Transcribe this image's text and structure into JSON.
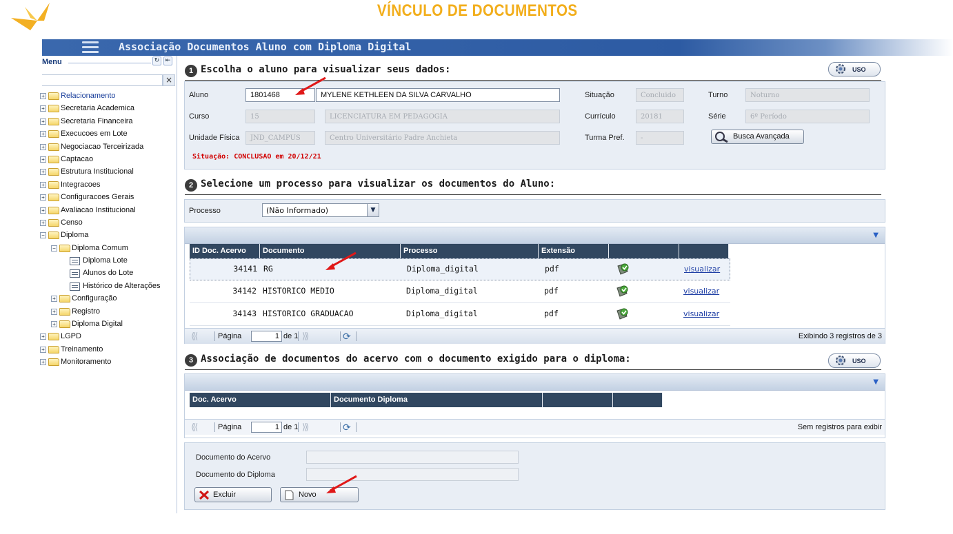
{
  "banner": {
    "title": "VÍNCULO DE DOCUMENTOS"
  },
  "app": {
    "title": "Associação Documentos Aluno com Diploma Digital"
  },
  "sidebar": {
    "menu_label": "Menu",
    "search_clear": "×",
    "items": [
      {
        "label": "Relacionamento",
        "level": 0,
        "icon": "folder-icon",
        "expander": "plus",
        "active": true
      },
      {
        "label": "Secretaria Academica",
        "level": 0,
        "icon": "folder-icon",
        "expander": "plus"
      },
      {
        "label": "Secretaria Financeira",
        "level": 0,
        "icon": "folder-icon",
        "expander": "plus"
      },
      {
        "label": "Execucoes em Lote",
        "level": 0,
        "icon": "folder-icon",
        "expander": "plus"
      },
      {
        "label": "Negociacao Terceirizada",
        "level": 0,
        "icon": "folder-icon",
        "expander": "plus"
      },
      {
        "label": "Captacao",
        "level": 0,
        "icon": "folder-icon",
        "expander": "plus"
      },
      {
        "label": "Estrutura Institucional",
        "level": 0,
        "icon": "folder-icon",
        "expander": "plus"
      },
      {
        "label": "Integracoes",
        "level": 0,
        "icon": "folder-icon",
        "expander": "plus"
      },
      {
        "label": "Configuracoes Gerais",
        "level": 0,
        "icon": "folder-icon",
        "expander": "plus"
      },
      {
        "label": "Avaliacao Institucional",
        "level": 0,
        "icon": "folder-icon",
        "expander": "plus"
      },
      {
        "label": "Censo",
        "level": 0,
        "icon": "folder-icon",
        "expander": "plus"
      },
      {
        "label": "Diploma",
        "level": 0,
        "icon": "open-folder-icon",
        "expander": "minus"
      },
      {
        "label": "Diploma Comum",
        "level": 1,
        "icon": "open-folder-icon",
        "expander": "minus"
      },
      {
        "label": "Diploma Lote",
        "level": 2,
        "icon": "page-icon",
        "expander": ""
      },
      {
        "label": "Alunos do Lote",
        "level": 2,
        "icon": "page-icon",
        "expander": ""
      },
      {
        "label": "Histórico de Alterações",
        "level": 2,
        "icon": "page-icon",
        "expander": ""
      },
      {
        "label": "Configuração",
        "level": 1,
        "icon": "folder-icon",
        "expander": "plus"
      },
      {
        "label": "Registro",
        "level": 1,
        "icon": "folder-icon",
        "expander": "plus"
      },
      {
        "label": "Diploma Digital",
        "level": 1,
        "icon": "folder-icon",
        "expander": "plus"
      },
      {
        "label": "LGPD",
        "level": 0,
        "icon": "folder-icon",
        "expander": "plus"
      },
      {
        "label": "Treinamento",
        "level": 0,
        "icon": "folder-icon",
        "expander": "plus"
      },
      {
        "label": "Monitoramento",
        "level": 0,
        "icon": "folder-icon",
        "expander": "plus"
      }
    ]
  },
  "section1": {
    "step": "1",
    "title": "Escolha o aluno para visualizar seus dados:",
    "uso_label": "USO",
    "labels": {
      "aluno": "Aluno",
      "curso": "Curso",
      "unidade": "Unidade Física",
      "situacao": "Situação",
      "curriculo": "Currículo",
      "turma": "Turma Pref.",
      "turno": "Turno",
      "serie": "Série"
    },
    "values": {
      "aluno_codigo": "1801468",
      "aluno_nome": "MYLENE KETHLEEN DA SILVA CARVALHO",
      "curso_codigo": "15",
      "curso_nome": "LICENCIATURA EM PEDAGOGIA",
      "unidade_codigo": "JND_CAMPUS",
      "unidade_nome": "Centro Universitário Padre Anchieta",
      "situacao": "Concluido",
      "curriculo": "20181",
      "turma": "-",
      "turno": "Noturno",
      "serie": "6º Período"
    },
    "busca_label": "Busca Avançada",
    "status_note": "Situação: CONCLUSAO em 20/12/21"
  },
  "section2": {
    "step": "2",
    "title": "Selecione um processo para visualizar os documentos do Aluno:",
    "processo_label": "Processo",
    "processo_value": "(Não Informado)",
    "grid": {
      "columns": [
        "ID Doc. Acervo",
        "Documento",
        "Processo",
        "Extensão",
        "",
        ""
      ],
      "rows": [
        {
          "id": "34141",
          "documento": "RG",
          "processo": "Diploma_digital",
          "extensao": "pdf",
          "link": "visualizar"
        },
        {
          "id": "34142",
          "documento": "HISTORICO MEDIO",
          "processo": "Diploma_digital",
          "extensao": "pdf",
          "link": "visualizar"
        },
        {
          "id": "34143",
          "documento": "HISTORICO GRADUACAO",
          "processo": "Diploma_digital",
          "extensao": "pdf",
          "link": "visualizar"
        }
      ]
    },
    "pager": {
      "page_label": "Página",
      "page_value": "1",
      "of_label": "de 1",
      "summary": "Exibindo 3 registros de 3"
    }
  },
  "section3": {
    "step": "3",
    "title": "Associação de documentos do acervo com o documento exigido para o diploma:",
    "uso_label": "USO",
    "grid": {
      "columns": [
        "Doc. Acervo",
        "Documento Diploma",
        "",
        ""
      ]
    },
    "pager": {
      "page_label": "Página",
      "page_value": "1",
      "of_label": "de 1",
      "summary": "Sem registros para exibir"
    },
    "form": {
      "doc_acervo_label": "Documento do Acervo",
      "doc_diploma_label": "Documento do Diploma",
      "doc_acervo_value": "",
      "doc_diploma_value": ""
    },
    "excluir_label": "Excluir",
    "novo_label": "Novo"
  },
  "colors": {
    "banner": "#f2ae1c",
    "titlebar": "#2d5ba3",
    "grid_header": "#314760",
    "alert": "#d10000",
    "annotation_arrow": "#e01818"
  }
}
